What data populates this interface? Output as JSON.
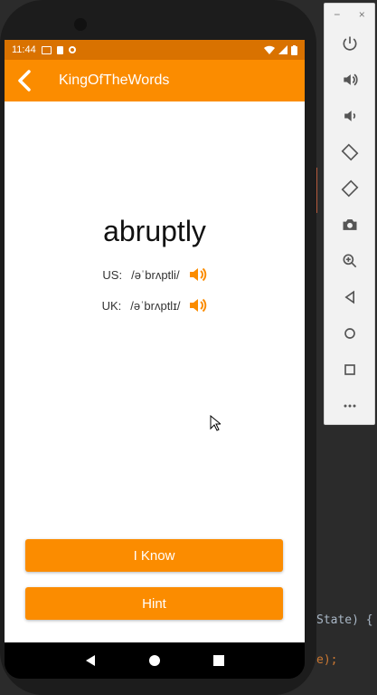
{
  "status": {
    "time": "11:44"
  },
  "app": {
    "title": "KingOfTheWords",
    "word": "abruptly",
    "us_label": "US:",
    "us_ipa": "/əˈbrʌptli/",
    "uk_label": "UK:",
    "uk_ipa": "/əˈbrʌptlɪ/",
    "know_label": "I Know",
    "hint_label": "Hint"
  },
  "ide": {
    "line1": "State) {",
    "line2": "e);"
  },
  "emulator_panel": {
    "top_minimize": "−",
    "top_close": "×",
    "buttons": [
      "power-icon",
      "volume-up-icon",
      "volume-down-icon",
      "rotate-left-icon",
      "rotate-right-icon",
      "camera-icon",
      "zoom-icon",
      "back-icon",
      "home-icon",
      "overview-icon",
      "more-icon"
    ]
  },
  "colors": {
    "accent": "#fb8c00",
    "status_bar": "#d97200"
  }
}
